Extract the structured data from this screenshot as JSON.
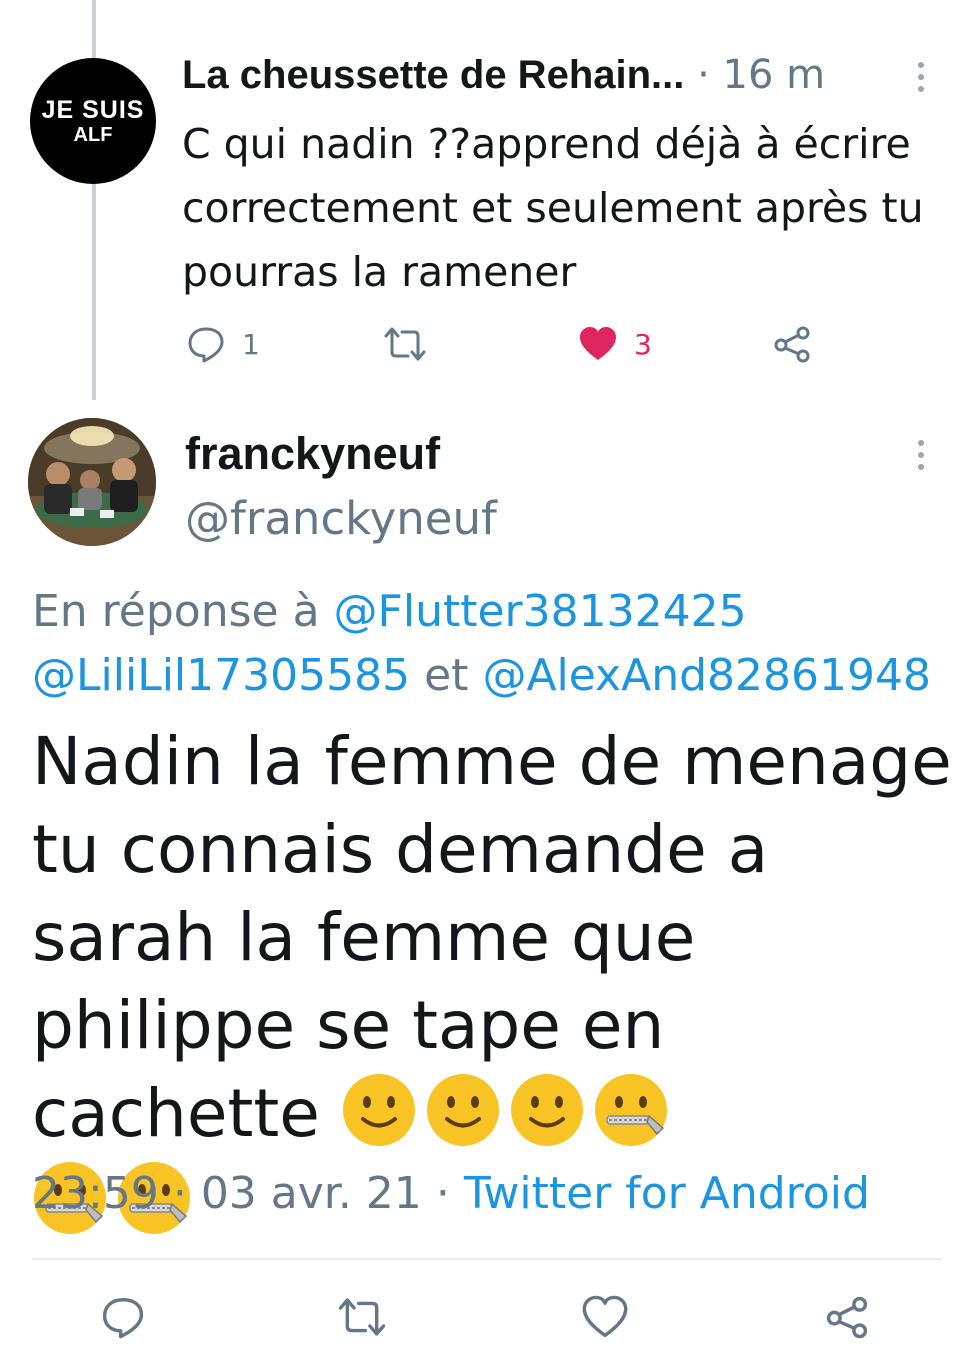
{
  "parent_tweet": {
    "avatar_text_line1": "JE SUIS",
    "avatar_text_line2": "ALF",
    "author_name": "La cheussette de Rehain...",
    "separator": "·",
    "time": "16 m",
    "text": "C qui nadin ??apprend déjà à écrire correctement et seulement après tu pourras la ramener",
    "reply_count": "1",
    "like_count": "3",
    "like_color": "#e0245e"
  },
  "tweet": {
    "author_name": "franckyneuf",
    "handle": "@franckyneuf",
    "reply_prefix": "En réponse à",
    "mention_1": "@Flutter38132425",
    "mention_2": "@LiliLil17305585",
    "reply_conj": "et",
    "mention_3": "@AlexAnd82861948",
    "text": "Nadin la femme de menage tu connais demande a sarah la femme que philippe se tape en cachette",
    "emojis": [
      "slightly-smiling-face",
      "slightly-smiling-face",
      "slightly-smiling-face",
      "zipper-mouth-face",
      "zipper-mouth-face",
      "zipper-mouth-face"
    ],
    "time": "23:59",
    "sep": "·",
    "date": "03 avr. 21",
    "source": "Twitter for Android"
  },
  "icons": {
    "reply": "reply-icon",
    "retweet": "retweet-icon",
    "like": "heart-icon",
    "share": "share-icon",
    "more": "more-vertical-icon"
  },
  "colors": {
    "link": "#1b95e0",
    "secondary_text": "#657786",
    "emoji_yellow": "#f7c325"
  }
}
